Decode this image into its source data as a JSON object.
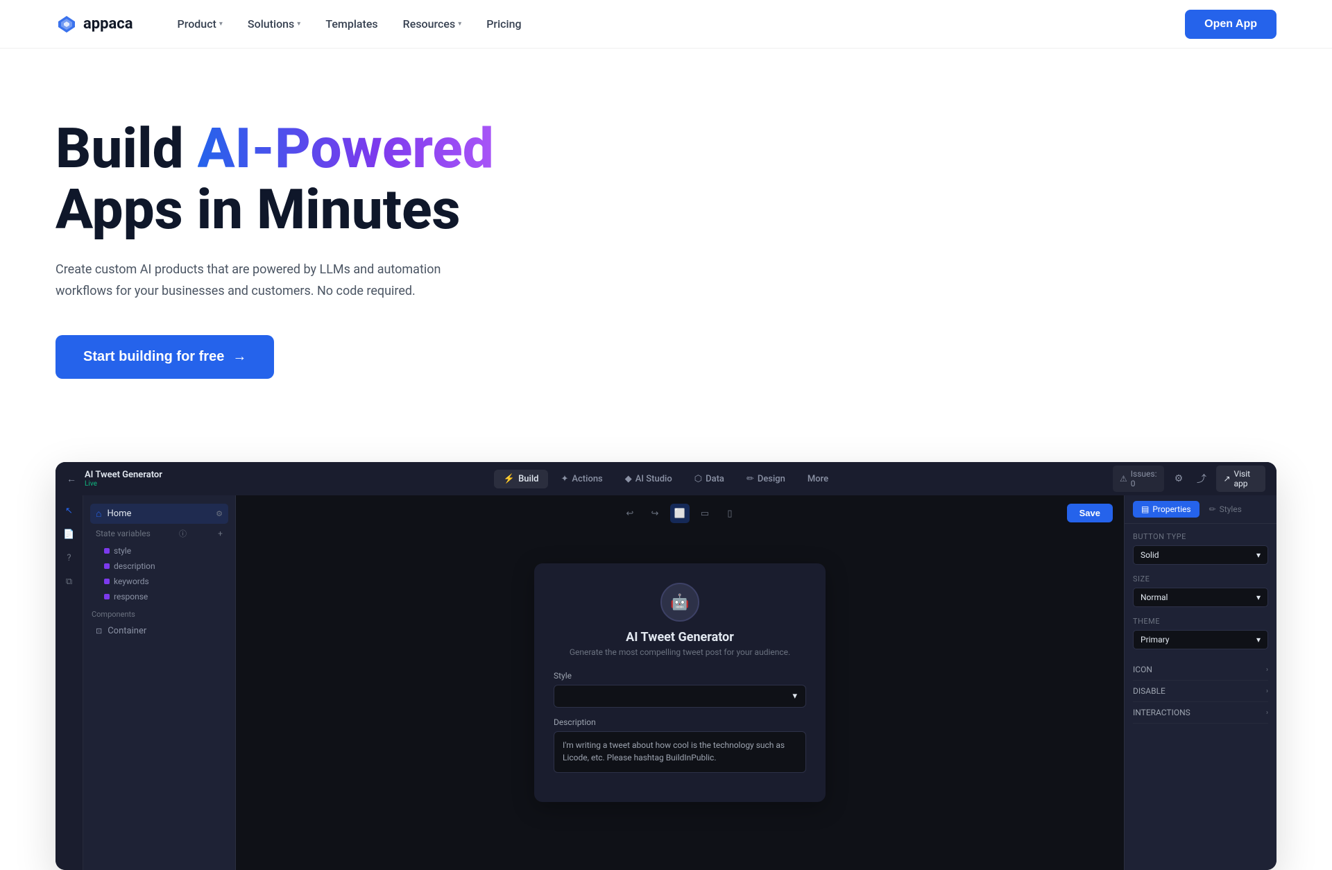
{
  "brand": {
    "name": "appaca",
    "logo_icon": "✦"
  },
  "nav": {
    "items": [
      {
        "label": "Product",
        "has_dropdown": true
      },
      {
        "label": "Solutions",
        "has_dropdown": true
      },
      {
        "label": "Templates",
        "has_dropdown": false
      },
      {
        "label": "Resources",
        "has_dropdown": true
      },
      {
        "label": "Pricing",
        "has_dropdown": false
      }
    ],
    "cta_label": "Open App"
  },
  "hero": {
    "title_static": "Build ",
    "title_gradient": "AI-Powered",
    "title_end": " Apps in Minutes",
    "subtitle": "Create custom AI products that are powered by LLMs and automation workflows for your businesses and customers. No code required.",
    "cta_label": "Start building for free",
    "cta_arrow": "→"
  },
  "app_screenshot": {
    "app_name": "AI Tweet Generator",
    "app_status": "Live",
    "tabs": [
      {
        "label": "Build",
        "icon": "⚡",
        "active": true
      },
      {
        "label": "Actions",
        "icon": "✦",
        "active": false
      },
      {
        "label": "AI Studio",
        "icon": "◆",
        "active": false
      },
      {
        "label": "Data",
        "icon": "⬡",
        "active": false
      },
      {
        "label": "Design",
        "icon": "✏",
        "active": false
      },
      {
        "label": "More",
        "icon": "···",
        "active": false
      }
    ],
    "header_right": {
      "issues_label": "Issues: 0",
      "visit_label": "Visit app"
    },
    "sidebar": {
      "home_label": "Home",
      "state_vars_label": "State variables",
      "variables": [
        "style",
        "description",
        "keywords",
        "response"
      ]
    },
    "canvas": {
      "save_label": "Save",
      "tweet_card": {
        "bot_icon": "🤖",
        "title": "AI Tweet Generator",
        "subtitle": "Generate the most compelling tweet post for your audience.",
        "style_label": "Style",
        "style_placeholder": "",
        "description_label": "Description",
        "description_value": "I'm writing a tweet about how cool is the technology such as Licode, etc. Please hashtag BuildInPublic."
      }
    },
    "properties": {
      "tab_properties": "Properties",
      "tab_styles": "Styles",
      "button_type_label": "Button type",
      "button_type_value": "Solid",
      "size_label": "Size",
      "size_value": "Normal",
      "theme_label": "Theme",
      "theme_value": "Primary",
      "icon_label": "ICON",
      "disable_label": "DISABLE",
      "interactions_label": "INTERACTIONS"
    },
    "components_label": "Components",
    "component_item": "Container"
  }
}
